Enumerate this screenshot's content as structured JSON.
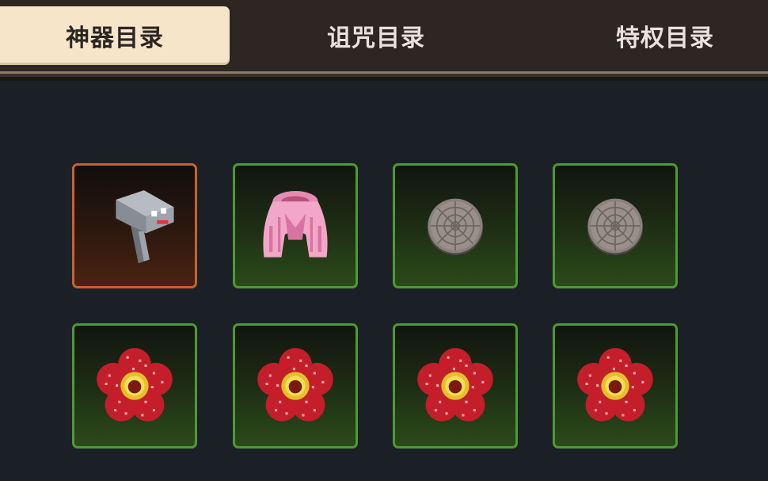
{
  "tabs": [
    {
      "label": "神器目录",
      "active": true
    },
    {
      "label": "诅咒目录",
      "active": false
    },
    {
      "label": "特权目录",
      "active": false
    }
  ],
  "grid": {
    "rows": [
      [
        {
          "icon": "pistol-camera-icon",
          "selected": true
        },
        {
          "icon": "pink-cloak-icon",
          "selected": false
        },
        {
          "icon": "manhole-cover-icon",
          "selected": false
        },
        {
          "icon": "manhole-cover-icon",
          "selected": false
        }
      ],
      [
        {
          "icon": "rafflesia-flower-icon",
          "selected": false
        },
        {
          "icon": "rafflesia-flower-icon",
          "selected": false
        },
        {
          "icon": "rafflesia-flower-icon",
          "selected": false
        },
        {
          "icon": "rafflesia-flower-icon",
          "selected": false
        }
      ]
    ]
  },
  "colors": {
    "background": "#1b2026",
    "active_tab": "#f6e5c9",
    "slot_border": "#4e9a32",
    "selected_border": "#c9622c"
  }
}
